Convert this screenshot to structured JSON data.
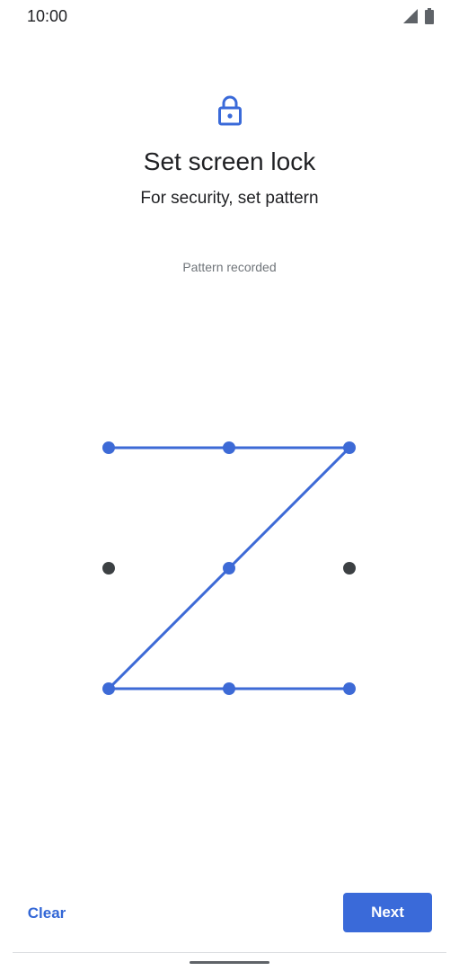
{
  "status_bar": {
    "time": "10:00",
    "icons": [
      "signal-icon",
      "battery-icon"
    ]
  },
  "header": {
    "icon": "lock-icon",
    "title": "Set screen lock",
    "subtitle": "For security, set pattern"
  },
  "pattern": {
    "status_text": "Pattern recorded",
    "grid_size": 3,
    "selected_sequence": [
      1,
      2,
      3,
      5,
      7,
      8,
      9
    ],
    "colors": {
      "active": "#3d6ad6",
      "inactive": "#3c4043"
    }
  },
  "footer": {
    "clear_label": "Clear",
    "next_label": "Next"
  },
  "colors": {
    "accent": "#3a6ad9",
    "text_primary": "#202124",
    "text_secondary": "#70757a"
  }
}
